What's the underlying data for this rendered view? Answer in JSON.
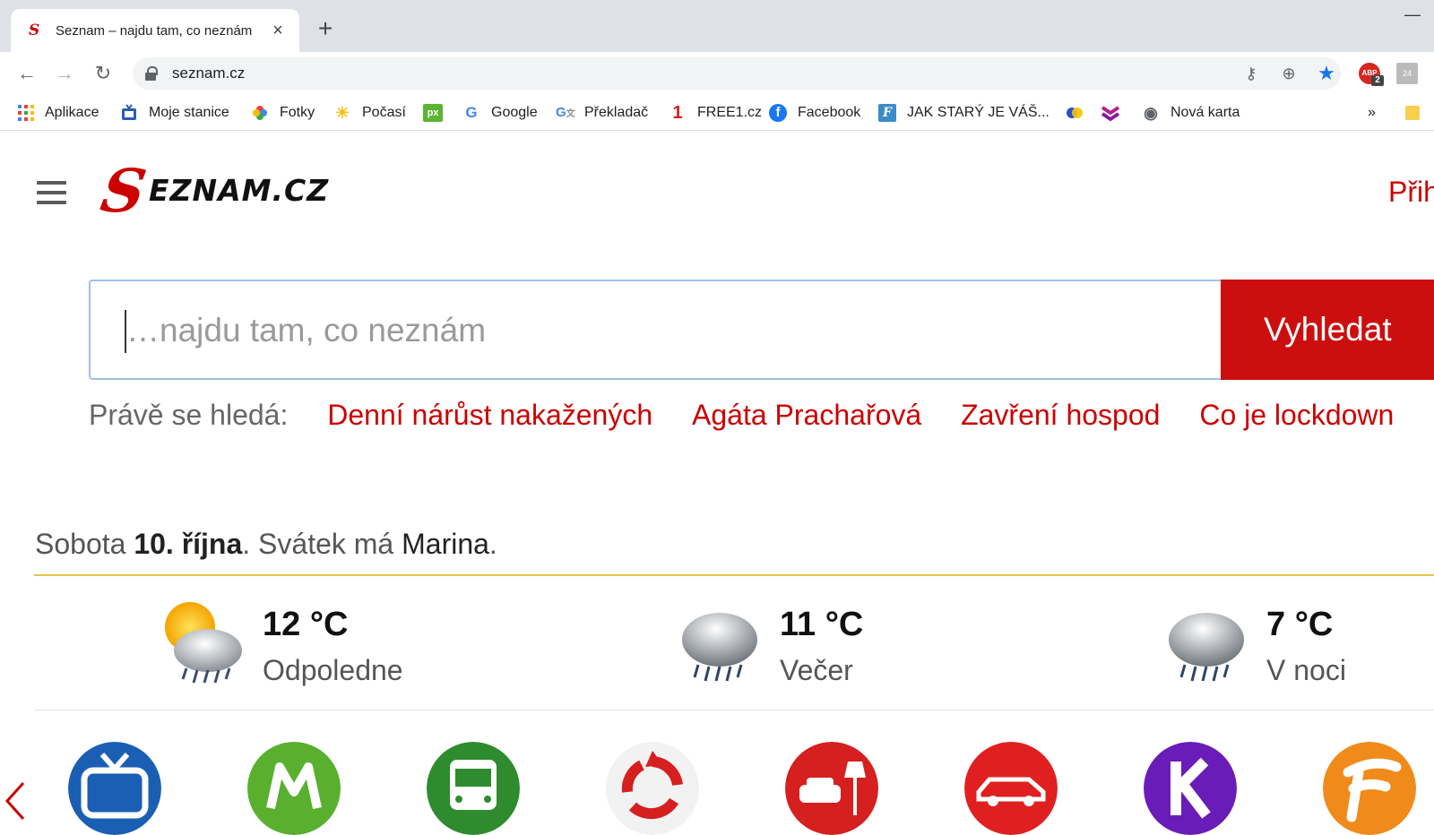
{
  "browser": {
    "tab_title": "Seznam – najdu tam, co neznám",
    "url": "seznam.cz",
    "bookmarks": [
      {
        "label": "Aplikace",
        "icon": "apps-grid-icon"
      },
      {
        "label": "Moje stanice",
        "icon": "tv-icon"
      },
      {
        "label": "Fotky",
        "icon": "photos-pinwheel-icon"
      },
      {
        "label": "Počasí",
        "icon": "sun-icon"
      },
      {
        "label": "",
        "icon": "px-icon"
      },
      {
        "label": "Google",
        "icon": "google-icon"
      },
      {
        "label": "Překladač",
        "icon": "translate-icon"
      },
      {
        "label": "FREE1.cz",
        "icon": "free1-icon"
      },
      {
        "label": "Facebook",
        "icon": "facebook-icon"
      },
      {
        "label": "JAK STARÝ JE VÁŠ...",
        "icon": "f-script-icon"
      },
      {
        "label": "",
        "icon": "circles-icon"
      },
      {
        "label": "",
        "icon": "chevrons-icon"
      },
      {
        "label": "Nová karta",
        "icon": "globe-icon"
      }
    ],
    "more_bookmarks": "»",
    "extensions": {
      "adblock_badge": "2",
      "adblock_text": "ABP",
      "ext_24": "24"
    }
  },
  "page": {
    "logo_s": "S",
    "logo_text": "EZNAM.CZ",
    "login_label": "Přih",
    "search": {
      "placeholder": "…najdu tam, co neznám",
      "button_label": "Vyhledat"
    },
    "trending": {
      "label": "Právě se hledá:",
      "items": [
        "Denní nárůst nakažených",
        "Agáta Prachařová",
        "Zavření hospod",
        "Co je lockdown"
      ]
    },
    "date": {
      "weekday": "Sobota",
      "date": "10. října",
      "mid": ". Svátek má",
      "name": "Marina",
      "end": "."
    },
    "weather": [
      {
        "temp": "12 °C",
        "label": "Odpoledne",
        "icon": "sun-cloud-rain-icon"
      },
      {
        "temp": "11 °C",
        "label": "Večer",
        "icon": "cloud-rain-icon"
      },
      {
        "temp": "7 °C",
        "label": "V noci",
        "icon": "cloud-rain-icon"
      }
    ],
    "services": [
      {
        "name": "tv",
        "color": "#1a5fb4",
        "icon": "tv-service-icon"
      },
      {
        "name": "m",
        "color": "#58b02e",
        "icon": "m-service-icon",
        "letter": "M"
      },
      {
        "name": "bus",
        "color": "#2e8b2e",
        "icon": "bus-service-icon"
      },
      {
        "name": "recycle",
        "color": "#d61f1f",
        "icon": "recycle-service-icon"
      },
      {
        "name": "furniture",
        "color": "#d61f1f",
        "icon": "furniture-service-icon"
      },
      {
        "name": "car",
        "color": "#e02020",
        "icon": "car-service-icon"
      },
      {
        "name": "k",
        "color": "#6a1cb8",
        "icon": "k-service-icon",
        "letter": "K"
      },
      {
        "name": "f",
        "color": "#f08a1a",
        "icon": "f-service-icon",
        "letter": "F"
      }
    ]
  }
}
